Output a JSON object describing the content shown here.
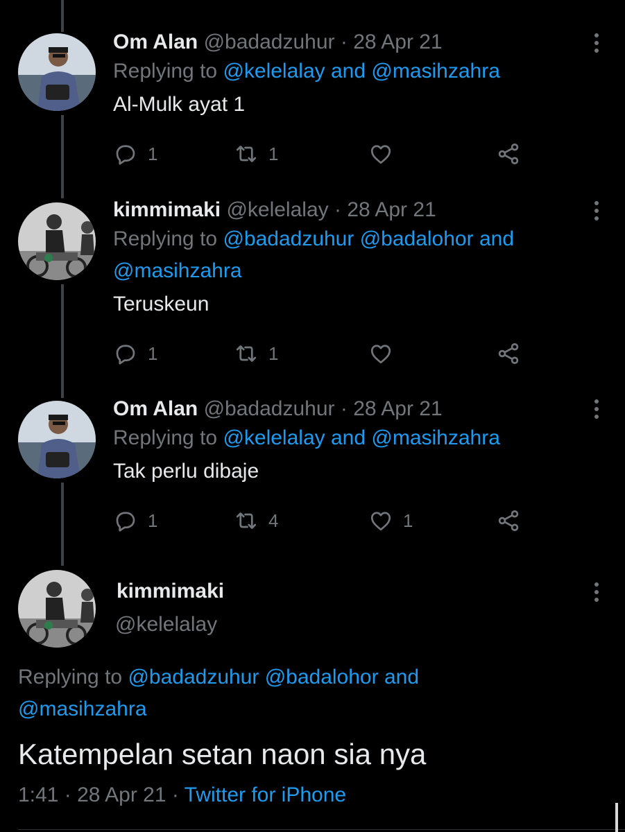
{
  "tweets": [
    {
      "name": "Om Alan",
      "handle": "@badadzuhur",
      "sep": "·",
      "date": "28 Apr 21",
      "reply_prefix": "Replying to",
      "mentions_line1": [
        "@kelelalay",
        "and",
        "@masihzahra"
      ],
      "text": "Al-Mulk ayat 1",
      "replies": "1",
      "retweets": "1",
      "likes": ""
    },
    {
      "name": "kimmimaki",
      "handle": "@kelelalay",
      "sep": "·",
      "date": "28 Apr 21",
      "reply_prefix": "Replying to",
      "mentions_line1": [
        "@badadzuhur",
        "@badalohor",
        "and"
      ],
      "mentions_line2": "@masihzahra",
      "text": "Teruskeun",
      "replies": "1",
      "retweets": "1",
      "likes": ""
    },
    {
      "name": "Om Alan",
      "handle": "@badadzuhur",
      "sep": "·",
      "date": "28 Apr 21",
      "reply_prefix": "Replying to",
      "mentions_line1": [
        "@kelelalay",
        "and",
        "@masihzahra"
      ],
      "text": "Tak perlu dibaje",
      "replies": "1",
      "retweets": "4",
      "likes": "1"
    }
  ],
  "main": {
    "name": "kimmimaki",
    "handle": "@kelelalay",
    "reply_prefix": "Replying to",
    "mentions_line1": [
      "@badadzuhur",
      "@badalohor",
      "and"
    ],
    "mentions_line2": "@masihzahra",
    "text": "Katempelan setan naon sia nya",
    "time": "1:41",
    "sep": "·",
    "date": "28 Apr 21",
    "source": "Twitter for iPhone"
  },
  "icons": {
    "reply": "reply-icon",
    "retweet": "retweet-icon",
    "like": "heart-icon",
    "share": "share-icon",
    "more": "more-icon"
  },
  "colors": {
    "background": "#000000",
    "text": "#e7e9ea",
    "secondary": "#71767b",
    "link": "#1d9bf0"
  }
}
